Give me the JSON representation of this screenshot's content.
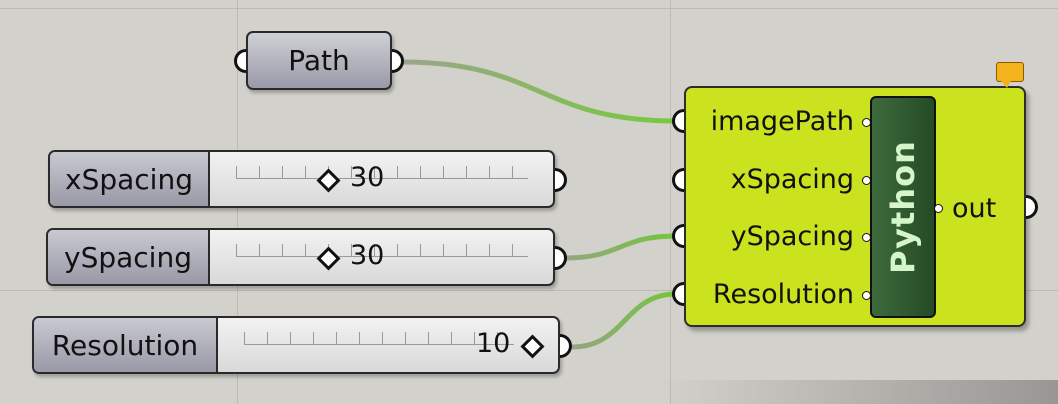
{
  "canvas": {
    "background": "#d3d1cb"
  },
  "path_param": {
    "label": "Path"
  },
  "sliders": [
    {
      "name": "xSpacing",
      "value": "30"
    },
    {
      "name": "ySpacing",
      "value": "30"
    },
    {
      "name": "Resolution",
      "value": "10"
    }
  ],
  "python_component": {
    "title": "Python",
    "inputs": [
      "imagePath",
      "xSpacing",
      "ySpacing",
      "Resolution"
    ],
    "output": "out",
    "color": "#cbe21f",
    "note_icon": "comment-bubble-icon"
  },
  "wire_color": "#7ac43f"
}
